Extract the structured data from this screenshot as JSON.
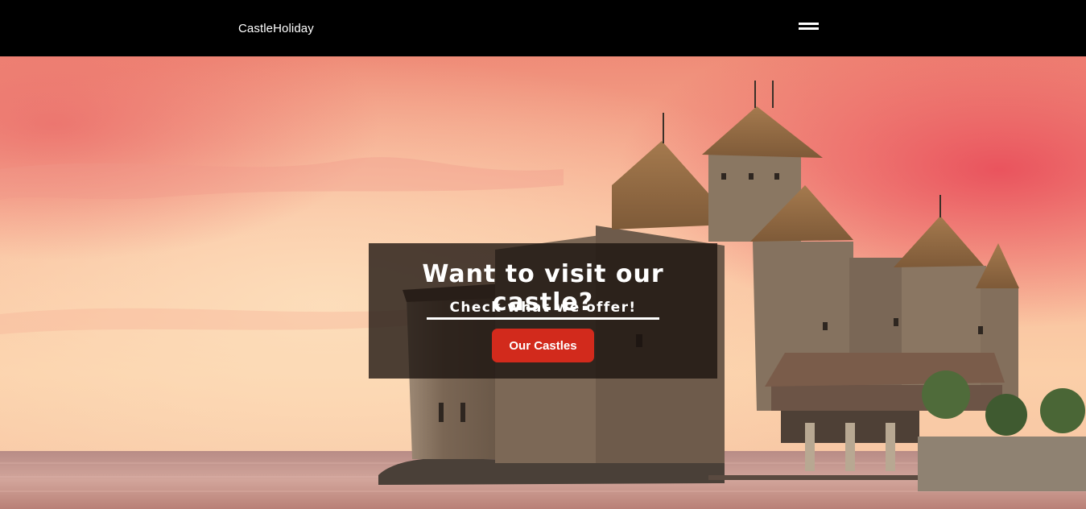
{
  "navbar": {
    "brand": "CastleHoliday",
    "menu_icon": "hamburger-menu-icon"
  },
  "hero": {
    "background_image": "castle-on-lake-at-sunset",
    "title": "Want to visit our castle?",
    "subtitle": "Check what we offer!",
    "cta_label": "Our Castles"
  },
  "colors": {
    "navbar_bg": "#000000",
    "cta_bg": "#d22a1c",
    "overlay": "rgba(25,18,14,0.78)",
    "sky_top": "#f4a08a",
    "sky_glow": "#fbd2b0",
    "water": "#c99a8e"
  }
}
